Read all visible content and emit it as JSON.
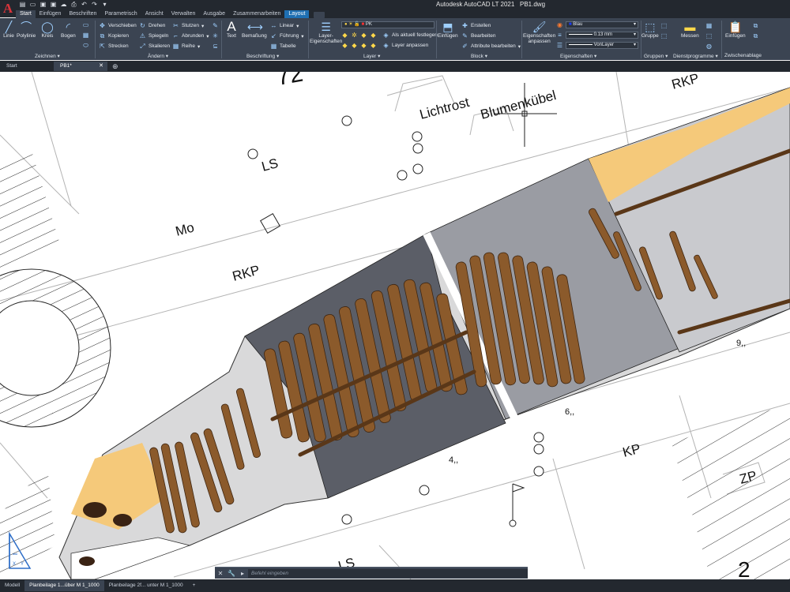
{
  "titlebar": {
    "app_title": "Autodesk AutoCAD LT 2021",
    "file_name": "PB1.dwg"
  },
  "appmenu": {
    "logo": "A"
  },
  "ribbon_tabs": [
    {
      "label": "Start"
    },
    {
      "label": "Einfügen"
    },
    {
      "label": "Beschriften"
    },
    {
      "label": "Parametrisch"
    },
    {
      "label": "Ansicht"
    },
    {
      "label": "Verwalten"
    },
    {
      "label": "Ausgabe"
    },
    {
      "label": "Zusammenarbeiten"
    },
    {
      "label": "Layout"
    }
  ],
  "ribbon": {
    "zeichnen": {
      "title": "Zeichnen",
      "linie": "Linie",
      "polylinie": "Polylinie",
      "kreis": "Kreis",
      "bogen": "Bogen"
    },
    "aendern": {
      "title": "Ändern",
      "verschieben": "Verschieben",
      "drehen": "Drehen",
      "stutzen": "Stutzen",
      "kopieren": "Kopieren",
      "spiegeln": "Spiegeln",
      "abrunden": "Abrunden",
      "strecken": "Strecken",
      "skalieren": "Skalieren",
      "reihe": "Reihe"
    },
    "beschriftung": {
      "title": "Beschriftung",
      "text": "Text",
      "bemassung": "Bemaßung",
      "linear": "Linear",
      "fuehrung": "Führung",
      "tabelle": "Tabelle"
    },
    "layer": {
      "title": "Layer",
      "layer_eig": "Layer-",
      "layer_eig2": "Eigenschaften",
      "current_layer": "PK",
      "als_aktuell": "Als aktuell festlegen",
      "layer_anpassen": "Layer anpassen"
    },
    "block": {
      "title": "Block",
      "einfuegen": "Einfügen",
      "erstellen": "Erstellen",
      "bearbeiten": "Bearbeiten",
      "attribute": "Attribute bearbeiten"
    },
    "eigenschaften": {
      "title": "Eigenschaften",
      "anpassen": "Eigenschaften",
      "anpassen2": "anpassen",
      "color": "Blau",
      "lineweight": "0.13 mm",
      "linetype": "VonLayer",
      "color_swatch": "#1a3cff"
    },
    "gruppen": {
      "title": "Gruppen",
      "gruppe": "Gruppe"
    },
    "dienstprogramme": {
      "title": "Dienstprogramme",
      "messen": "Messen"
    },
    "zwischenablage": {
      "title": "Zwischenablage",
      "einfuegen": "Einfügen"
    }
  },
  "doc_tabs": {
    "start": "Start",
    "file": "PB1*"
  },
  "drawing_labels": {
    "street_num": "72",
    "lichtrost": "Lichtrost",
    "blumenkuebel": "Blumenkübel",
    "rkp_top": "RKP",
    "ls_top": "LS",
    "mo": "Mo",
    "rkp_mid": "RKP",
    "kp": "KP",
    "zp": "ZP",
    "ls_bottom": "LS",
    "dim_9": "9,,",
    "dim_6": "6,,",
    "dim_4": "4,,",
    "big_2": "2"
  },
  "cmdline": {
    "placeholder": "Befehl eingeben"
  },
  "layout_tabs": {
    "modell": "Modell",
    "plan1": "Planbeilage 1...über M 1_1000",
    "plan2": "Planbeilage 2f... unter M 1_1000"
  },
  "colors": {
    "wood": "#8b5a2b",
    "wood_dark": "#5a3718",
    "grey_dark": "#5b5e67",
    "grey_mid": "#9a9ca3",
    "grey_light": "#c9cace",
    "sand": "#f5c97a",
    "ribbon_bg": "#3b4452",
    "titlebar_bg": "#23282f"
  }
}
